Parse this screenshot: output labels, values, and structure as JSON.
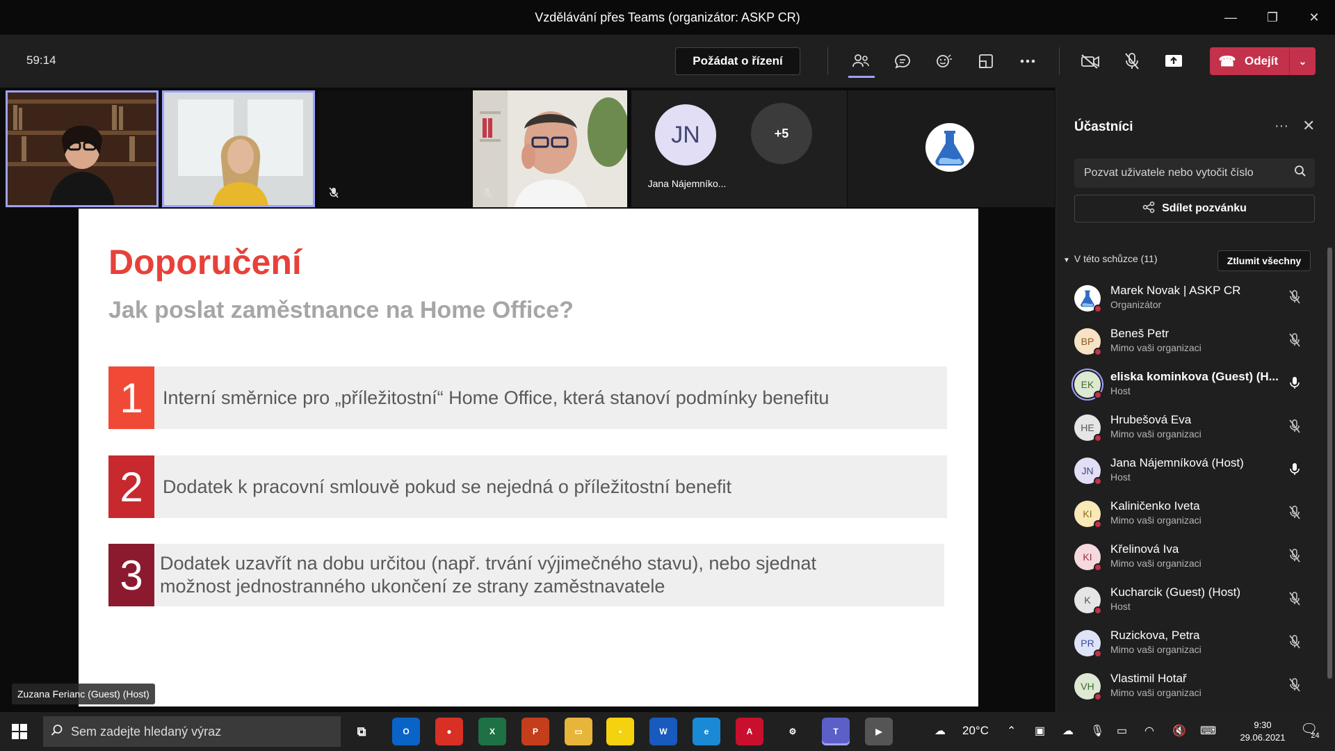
{
  "window": {
    "title": "Vzdělávání přes Teams (organizátor: ASKP CR)",
    "minimize": "—",
    "restore": "❐",
    "close": "✕"
  },
  "toolbar": {
    "timer": "59:14",
    "request_control": "Požádat o řízení",
    "leave": "Odejít"
  },
  "gallery": {
    "tiles": [
      {
        "name": "video-tile-1",
        "kind": "video"
      },
      {
        "name": "video-tile-2",
        "kind": "video"
      },
      {
        "name": "video-tile-3",
        "kind": "blank"
      },
      {
        "name": "video-tile-4",
        "kind": "video"
      }
    ],
    "avatar_initials": "JN",
    "avatar_name": "Jana Nájemníko...",
    "more_count": "+5"
  },
  "slide": {
    "title": "Doporučení",
    "subtitle": "Jak poslat zaměstnance na Home Office?",
    "items": [
      {
        "num": "1",
        "text": "Interní směrnice pro „příležitostní“ Home Office, která stanoví podmínky benefitu",
        "color": "#f04a37"
      },
      {
        "num": "2",
        "text": "Dodatek k pracovní smlouvě pokud se nejedná o příležitostní benefit",
        "color": "#c8292e"
      },
      {
        "num": "3",
        "text": "Dodatek uzavřít na dobu určitou (např. trvání výjimečného stavu), nebo sjednat možnost jednostranného ukončení ze strany zaměstnavatele",
        "color": "#8b1a2e"
      }
    ]
  },
  "presenter_name": "Zuzana Ferianc (Guest) (Host)",
  "panel": {
    "title": "Účastníci",
    "invite_placeholder": "Pozvat uživatele nebo vytočit číslo",
    "share_invite": "Sdílet pozvánku",
    "section": "V této schůzce (11)",
    "mute_all": "Ztlumit všechny",
    "participants": [
      {
        "initials": "",
        "name": "Marek Novak | ASKP CR",
        "role": "Organizátor",
        "av_bg": "#ffffff",
        "av_fg": "#2b6cb0",
        "status": "#c4314b",
        "bold": false,
        "mic": "muted"
      },
      {
        "initials": "BP",
        "name": "Beneš Petr",
        "role": "Mimo vaši organizaci",
        "av_bg": "#f6e3c6",
        "av_fg": "#8a5a1c",
        "status": "#c4314b",
        "bold": false,
        "mic": "muted"
      },
      {
        "initials": "EK",
        "name": "eliska kominkova (Guest) (H...",
        "role": "Host",
        "av_bg": "#dde9d3",
        "av_fg": "#3f6a2b",
        "status": "#c4314b",
        "bold": true,
        "mic": "on"
      },
      {
        "initials": "HE",
        "name": "Hrubešová Eva",
        "role": "Mimo vaši organizaci",
        "av_bg": "#e5e5e5",
        "av_fg": "#555555",
        "status": "#c4314b",
        "bold": false,
        "mic": "muted"
      },
      {
        "initials": "JN",
        "name": "Jana Nájemníková (Host)",
        "role": "Host",
        "av_bg": "#e2def5",
        "av_fg": "#424675",
        "status": "#c4314b",
        "bold": false,
        "mic": "on"
      },
      {
        "initials": "KI",
        "name": "Kaliničenko Iveta",
        "role": "Mimo vaši organizaci",
        "av_bg": "#f9e8b8",
        "av_fg": "#8a6d12",
        "status": "#c4314b",
        "bold": false,
        "mic": "muted"
      },
      {
        "initials": "KI",
        "name": "Křelinová Iva",
        "role": "Mimo vaši organizaci",
        "av_bg": "#f6d9de",
        "av_fg": "#9b2d40",
        "status": "#c4314b",
        "bold": false,
        "mic": "muted"
      },
      {
        "initials": "K",
        "name": "Kucharcik (Guest) (Host)",
        "role": "Host",
        "av_bg": "#e5e5e5",
        "av_fg": "#555555",
        "status": "#c4314b",
        "bold": false,
        "mic": "muted"
      },
      {
        "initials": "PR",
        "name": "Ruzickova, Petra",
        "role": "Mimo vaši organizaci",
        "av_bg": "#dfe3f7",
        "av_fg": "#3c4a9e",
        "status": "#c4314b",
        "bold": false,
        "mic": "muted"
      },
      {
        "initials": "VH",
        "name": "Vlastimil Hotař",
        "role": "Mimo vaši organizaci",
        "av_bg": "#dde9d3",
        "av_fg": "#3f6a2b",
        "status": "#c4314b",
        "bold": false,
        "mic": "muted"
      }
    ]
  },
  "taskbar": {
    "search_placeholder": "Sem zadejte hledaný výraz",
    "apps": [
      {
        "name": "outlook-app",
        "label": "O",
        "bg": "#0a64c8"
      },
      {
        "name": "chrome-app",
        "label": "●",
        "bg": "#d93025"
      },
      {
        "name": "excel-app",
        "label": "X",
        "bg": "#1e7145"
      },
      {
        "name": "powerpoint-app",
        "label": "P",
        "bg": "#c43e1c"
      },
      {
        "name": "explorer-app",
        "label": "▭",
        "bg": "#e7b53a"
      },
      {
        "name": "sticky-notes-app",
        "label": "▪",
        "bg": "#f5d20f"
      },
      {
        "name": "word-app",
        "label": "W",
        "bg": "#185abd"
      },
      {
        "name": "edge-app",
        "label": "e",
        "bg": "#1b8ad6"
      },
      {
        "name": "acrobat-app",
        "label": "A",
        "bg": "#c8102e"
      },
      {
        "name": "settings-app",
        "label": "⚙",
        "bg": "#202020"
      },
      {
        "name": "teams-app",
        "label": "T",
        "bg": "#5b5fc7"
      },
      {
        "name": "media-app",
        "label": "▶",
        "bg": "#555555"
      }
    ],
    "weather": "20°C",
    "time": "9:30",
    "date": "29.06.2021",
    "notifications": "24"
  }
}
